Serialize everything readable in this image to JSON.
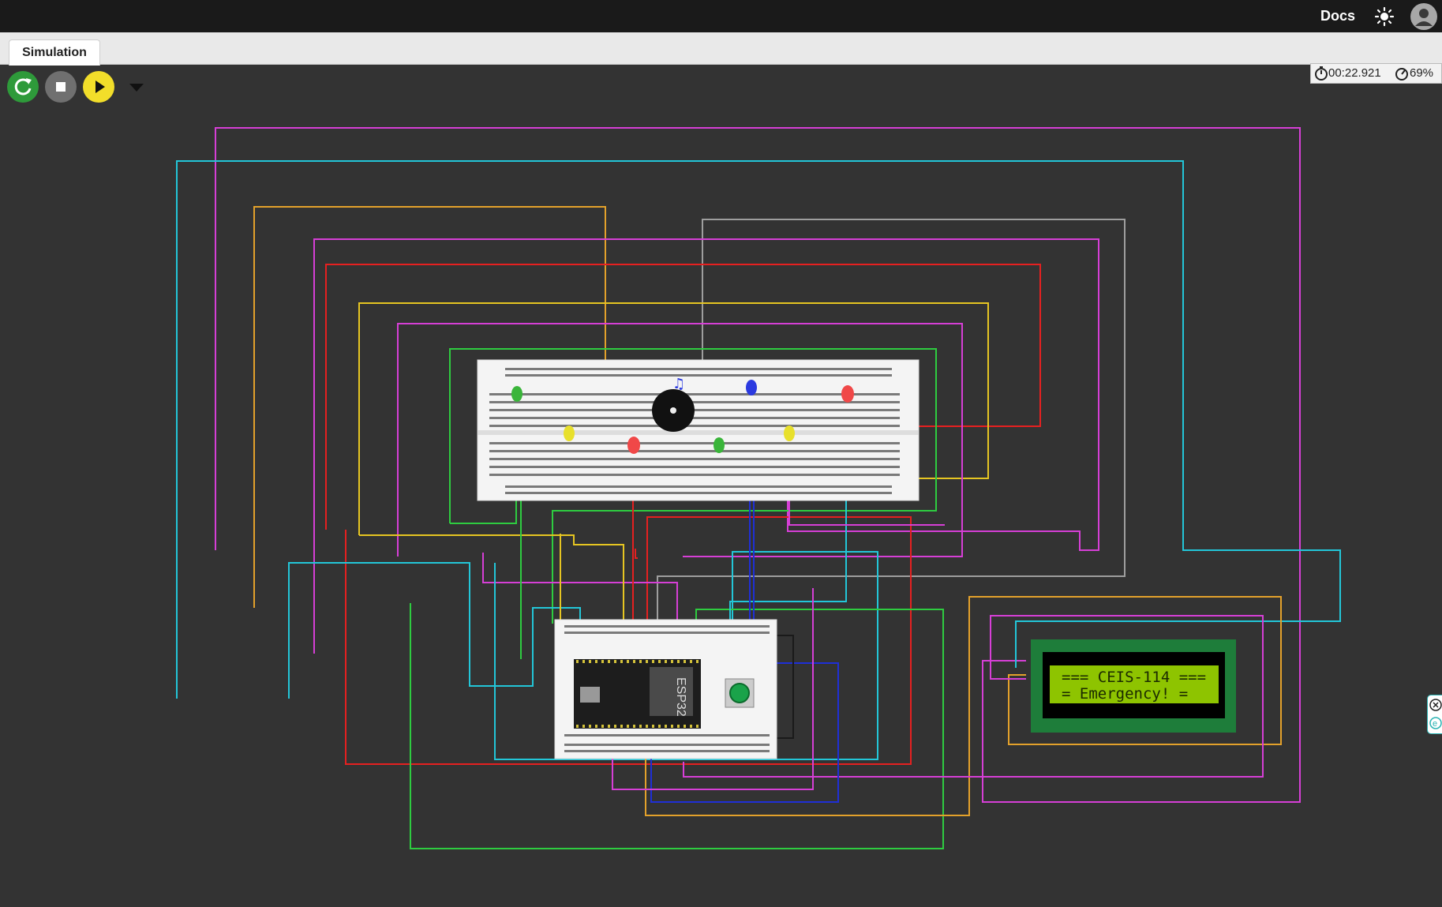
{
  "topbar": {
    "docs_label": "Docs",
    "theme_icon": "sun-icon",
    "avatar_icon": "user-avatar-icon"
  },
  "tabs": [
    {
      "label": "Simulation"
    }
  ],
  "controls": {
    "restart_icon": "restart-icon",
    "stop_icon": "stop-icon",
    "play_icon": "play-icon",
    "menu_icon": "chevron-down-icon"
  },
  "status": {
    "time": "00:22.921",
    "speed": "69%"
  },
  "lcd": {
    "line1": "=== CEIS-114 ===",
    "line2": "= Emergency! ="
  },
  "board": {
    "label": "ESP32"
  },
  "colors": {
    "background": "#333333",
    "lcd_text": "#1b2a00",
    "lcd_screen": "#8ec400",
    "lcd_board": "#1e7d3a"
  }
}
